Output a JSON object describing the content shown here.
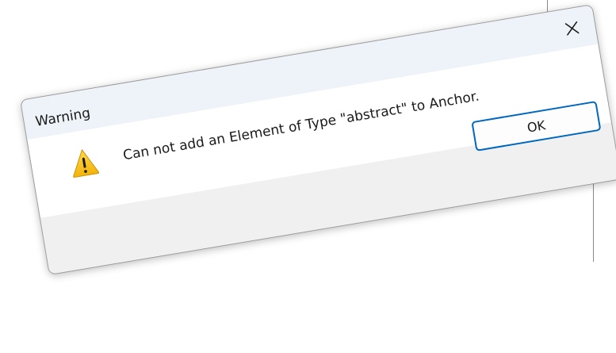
{
  "dialog": {
    "title": "Warning",
    "message": "Can not add an Element of Type \"abstract\" to Anchor.",
    "ok_label": "OK",
    "icon": "warning-icon",
    "close_icon": "close-icon"
  },
  "colors": {
    "title_bar": "#eef3f9",
    "footer": "#f0f0f0",
    "ok_border": "#0067c0",
    "warning_yellow": "#f7c31a"
  }
}
